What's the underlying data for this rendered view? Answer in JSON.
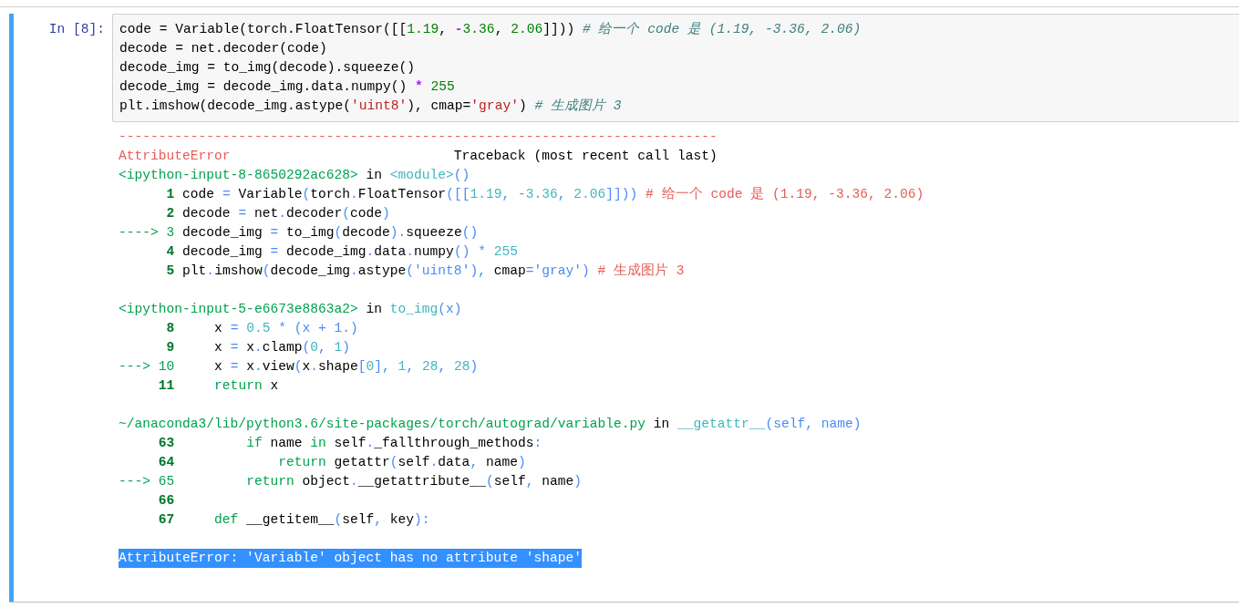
{
  "cell": {
    "selected": true,
    "prompt": "In [8]:",
    "code": [
      [
        {
          "kind": "plain",
          "text": "code = Variable(torch.FloatTensor([["
        },
        {
          "kind": "number",
          "text": "1.19"
        },
        {
          "kind": "plain",
          "text": ", "
        },
        {
          "kind": "operator",
          "text": "-"
        },
        {
          "kind": "number",
          "text": "3.36"
        },
        {
          "kind": "plain",
          "text": ", "
        },
        {
          "kind": "number",
          "text": "2.06"
        },
        {
          "kind": "plain",
          "text": "]])) "
        },
        {
          "kind": "comment",
          "text": "# 给一个 code 是 (1.19, -3.36, 2.06)"
        }
      ],
      [
        {
          "kind": "plain",
          "text": "decode = net.decoder(code)"
        }
      ],
      [
        {
          "kind": "plain",
          "text": "decode_img = to_img(decode).squeeze()"
        }
      ],
      [
        {
          "kind": "plain",
          "text": "decode_img = decode_img.data.numpy() "
        },
        {
          "kind": "operator",
          "text": "*"
        },
        {
          "kind": "number",
          "text": " 255"
        }
      ],
      [
        {
          "kind": "plain",
          "text": "plt.imshow(decode_img.astype("
        },
        {
          "kind": "string",
          "text": "'uint8'"
        },
        {
          "kind": "plain",
          "text": "), cmap="
        },
        {
          "kind": "string",
          "text": "'gray'"
        },
        {
          "kind": "plain",
          "text": ") "
        },
        {
          "kind": "comment",
          "text": "# 生成图片 3"
        }
      ]
    ]
  },
  "output": {
    "rule": "---------------------------------------------------------------------------",
    "error_name": "AttributeError",
    "traceback_title": "Traceback (most recent call last)",
    "frames": [
      {
        "header": [
          {
            "kind": "path",
            "text": "<ipython-input-8-8650292ac628>"
          },
          {
            "kind": "plain",
            "text": " in "
          },
          {
            "kind": "name",
            "text": "<module>"
          },
          {
            "kind": "punct",
            "text": "()"
          }
        ],
        "lines": [
          {
            "number": "1",
            "current": false,
            "code": [
              {
                "kind": "plain",
                "text": "code "
              },
              {
                "kind": "punct",
                "text": "="
              },
              {
                "kind": "plain",
                "text": " Variable"
              },
              {
                "kind": "punct",
                "text": "("
              },
              {
                "kind": "plain",
                "text": "torch"
              },
              {
                "kind": "punct",
                "text": "."
              },
              {
                "kind": "plain",
                "text": "FloatTensor"
              },
              {
                "kind": "punct",
                "text": "([["
              },
              {
                "kind": "number",
                "text": "1.19"
              },
              {
                "kind": "punct",
                "text": ", -"
              },
              {
                "kind": "number",
                "text": "3.36"
              },
              {
                "kind": "punct",
                "text": ", "
              },
              {
                "kind": "number",
                "text": "2.06"
              },
              {
                "kind": "punct",
                "text": "]])) "
              },
              {
                "kind": "comment",
                "text": "# 给一个 code 是 (1.19, -3.36, 2.06)"
              }
            ]
          },
          {
            "number": "2",
            "current": false,
            "code": [
              {
                "kind": "plain",
                "text": "decode "
              },
              {
                "kind": "punct",
                "text": "="
              },
              {
                "kind": "plain",
                "text": " net"
              },
              {
                "kind": "punct",
                "text": "."
              },
              {
                "kind": "plain",
                "text": "decoder"
              },
              {
                "kind": "punct",
                "text": "("
              },
              {
                "kind": "plain",
                "text": "code"
              },
              {
                "kind": "punct",
                "text": ")"
              }
            ]
          },
          {
            "marker": "---->",
            "number": "3",
            "current": true,
            "code": [
              {
                "kind": "plain",
                "text": "decode_img "
              },
              {
                "kind": "punct",
                "text": "="
              },
              {
                "kind": "plain",
                "text": " to_img"
              },
              {
                "kind": "punct",
                "text": "("
              },
              {
                "kind": "plain",
                "text": "decode"
              },
              {
                "kind": "punct",
                "text": ")."
              },
              {
                "kind": "plain",
                "text": "squeeze"
              },
              {
                "kind": "punct",
                "text": "()"
              }
            ]
          },
          {
            "number": "4",
            "current": false,
            "code": [
              {
                "kind": "plain",
                "text": "decode_img "
              },
              {
                "kind": "punct",
                "text": "="
              },
              {
                "kind": "plain",
                "text": " decode_img"
              },
              {
                "kind": "punct",
                "text": "."
              },
              {
                "kind": "plain",
                "text": "data"
              },
              {
                "kind": "punct",
                "text": "."
              },
              {
                "kind": "plain",
                "text": "numpy"
              },
              {
                "kind": "punct",
                "text": "() * "
              },
              {
                "kind": "number",
                "text": "255"
              }
            ]
          },
          {
            "number": "5",
            "current": false,
            "code": [
              {
                "kind": "plain",
                "text": "plt"
              },
              {
                "kind": "punct",
                "text": "."
              },
              {
                "kind": "plain",
                "text": "imshow"
              },
              {
                "kind": "punct",
                "text": "("
              },
              {
                "kind": "plain",
                "text": "decode_img"
              },
              {
                "kind": "punct",
                "text": "."
              },
              {
                "kind": "plain",
                "text": "astype"
              },
              {
                "kind": "punct",
                "text": "('uint8'), "
              },
              {
                "kind": "plain",
                "text": "cmap"
              },
              {
                "kind": "punct",
                "text": "='gray') "
              },
              {
                "kind": "comment",
                "text": "# 生成图片 3"
              }
            ]
          }
        ]
      },
      {
        "header": [
          {
            "kind": "path",
            "text": "<ipython-input-5-e6673e8863a2>"
          },
          {
            "kind": "plain",
            "text": " in "
          },
          {
            "kind": "name",
            "text": "to_img"
          },
          {
            "kind": "punct",
            "text": "(x)"
          }
        ],
        "lines": [
          {
            "number": "8",
            "current": false,
            "code": [
              {
                "kind": "plain",
                "text": "    x "
              },
              {
                "kind": "punct",
                "text": "= "
              },
              {
                "kind": "number",
                "text": "0.5"
              },
              {
                "kind": "punct",
                "text": " * (x + 1.)"
              }
            ]
          },
          {
            "number": "9",
            "current": false,
            "code": [
              {
                "kind": "plain",
                "text": "    x "
              },
              {
                "kind": "punct",
                "text": "="
              },
              {
                "kind": "plain",
                "text": " x"
              },
              {
                "kind": "punct",
                "text": "."
              },
              {
                "kind": "plain",
                "text": "clamp"
              },
              {
                "kind": "punct",
                "text": "("
              },
              {
                "kind": "number",
                "text": "0"
              },
              {
                "kind": "punct",
                "text": ", "
              },
              {
                "kind": "number",
                "text": "1"
              },
              {
                "kind": "punct",
                "text": ")"
              }
            ]
          },
          {
            "marker": "--->",
            "number": "10",
            "current": true,
            "code": [
              {
                "kind": "plain",
                "text": "    x "
              },
              {
                "kind": "punct",
                "text": "="
              },
              {
                "kind": "plain",
                "text": " x"
              },
              {
                "kind": "punct",
                "text": "."
              },
              {
                "kind": "plain",
                "text": "view"
              },
              {
                "kind": "punct",
                "text": "("
              },
              {
                "kind": "plain",
                "text": "x"
              },
              {
                "kind": "punct",
                "text": "."
              },
              {
                "kind": "plain",
                "text": "shape"
              },
              {
                "kind": "punct",
                "text": "["
              },
              {
                "kind": "number",
                "text": "0"
              },
              {
                "kind": "punct",
                "text": "], "
              },
              {
                "kind": "number",
                "text": "1"
              },
              {
                "kind": "punct",
                "text": ", "
              },
              {
                "kind": "number",
                "text": "28"
              },
              {
                "kind": "punct",
                "text": ", "
              },
              {
                "kind": "number",
                "text": "28"
              },
              {
                "kind": "punct",
                "text": ")"
              }
            ]
          },
          {
            "number": "11",
            "current": false,
            "code": [
              {
                "kind": "keyword",
                "text": "    return"
              },
              {
                "kind": "plain",
                "text": " x"
              }
            ]
          }
        ]
      },
      {
        "header": [
          {
            "kind": "path",
            "text": "~/anaconda3/lib/python3.6/site-packages/torch/autograd/variable.py"
          },
          {
            "kind": "plain",
            "text": " in "
          },
          {
            "kind": "name",
            "text": "__getattr__"
          },
          {
            "kind": "punct",
            "text": "(self, name)"
          }
        ],
        "lines": [
          {
            "number": "63",
            "current": false,
            "code": [
              {
                "kind": "keyword",
                "text": "        if"
              },
              {
                "kind": "plain",
                "text": " name "
              },
              {
                "kind": "keyword",
                "text": "in"
              },
              {
                "kind": "plain",
                "text": " self"
              },
              {
                "kind": "punct",
                "text": "."
              },
              {
                "kind": "plain",
                "text": "_fallthrough_methods"
              },
              {
                "kind": "punct",
                "text": ":"
              }
            ]
          },
          {
            "number": "64",
            "current": false,
            "code": [
              {
                "kind": "keyword",
                "text": "            return"
              },
              {
                "kind": "plain",
                "text": " getattr"
              },
              {
                "kind": "punct",
                "text": "("
              },
              {
                "kind": "plain",
                "text": "self"
              },
              {
                "kind": "punct",
                "text": "."
              },
              {
                "kind": "plain",
                "text": "data"
              },
              {
                "kind": "punct",
                "text": ", "
              },
              {
                "kind": "plain",
                "text": "name"
              },
              {
                "kind": "punct",
                "text": ")"
              }
            ]
          },
          {
            "marker": "--->",
            "number": "65",
            "current": true,
            "code": [
              {
                "kind": "keyword",
                "text": "        return"
              },
              {
                "kind": "plain",
                "text": " object"
              },
              {
                "kind": "punct",
                "text": "."
              },
              {
                "kind": "plain",
                "text": "__getattribute__"
              },
              {
                "kind": "punct",
                "text": "("
              },
              {
                "kind": "plain",
                "text": "self"
              },
              {
                "kind": "punct",
                "text": ", "
              },
              {
                "kind": "plain",
                "text": "name"
              },
              {
                "kind": "punct",
                "text": ")"
              }
            ]
          },
          {
            "number": "66",
            "current": false
          },
          {
            "number": "67",
            "current": false,
            "code": [
              {
                "kind": "keyword",
                "text": "    def"
              },
              {
                "kind": "plain",
                "text": " __getitem__"
              },
              {
                "kind": "punct",
                "text": "("
              },
              {
                "kind": "plain",
                "text": "self"
              },
              {
                "kind": "punct",
                "text": ", "
              },
              {
                "kind": "plain",
                "text": "key"
              },
              {
                "kind": "punct",
                "text": "):"
              }
            ]
          }
        ]
      }
    ],
    "error": {
      "text": "AttributeError: 'Variable' object has no attribute 'shape'",
      "selected": true
    }
  }
}
